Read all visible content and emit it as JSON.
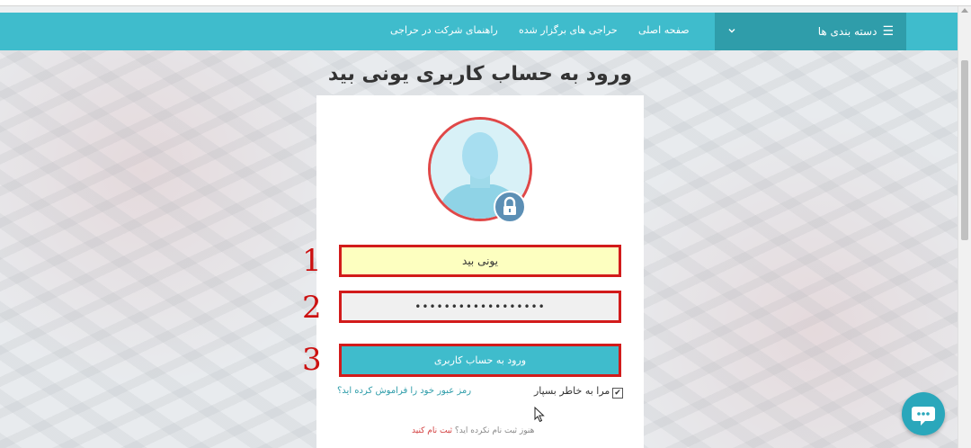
{
  "nav": {
    "categories_label": "دسته بندی ها",
    "links": [
      "صفحه اصلی",
      "حراجی های برگزار شده",
      "راهنمای شرکت در حراجی"
    ]
  },
  "page": {
    "title": "ورود به حساب کاربری یونی بید"
  },
  "form": {
    "username_value": "یونی بید",
    "password_value": "••••••••••••••••••",
    "submit_label": "ورود به حساب کاربری",
    "remember_label": "مرا به خاطر بسپار",
    "remember_checked": true,
    "forgot_label": "رمز عبور خود را فراموش کرده اید؟",
    "register_prompt": "هنوز ثبت نام نکرده اید؟",
    "register_link": "ثبت نام کنید"
  },
  "annotations": [
    "1",
    "2",
    "3"
  ],
  "colors": {
    "accent": "#3fbccc",
    "accent_dark": "#2f9daa",
    "highlight": "#d21b1b"
  }
}
